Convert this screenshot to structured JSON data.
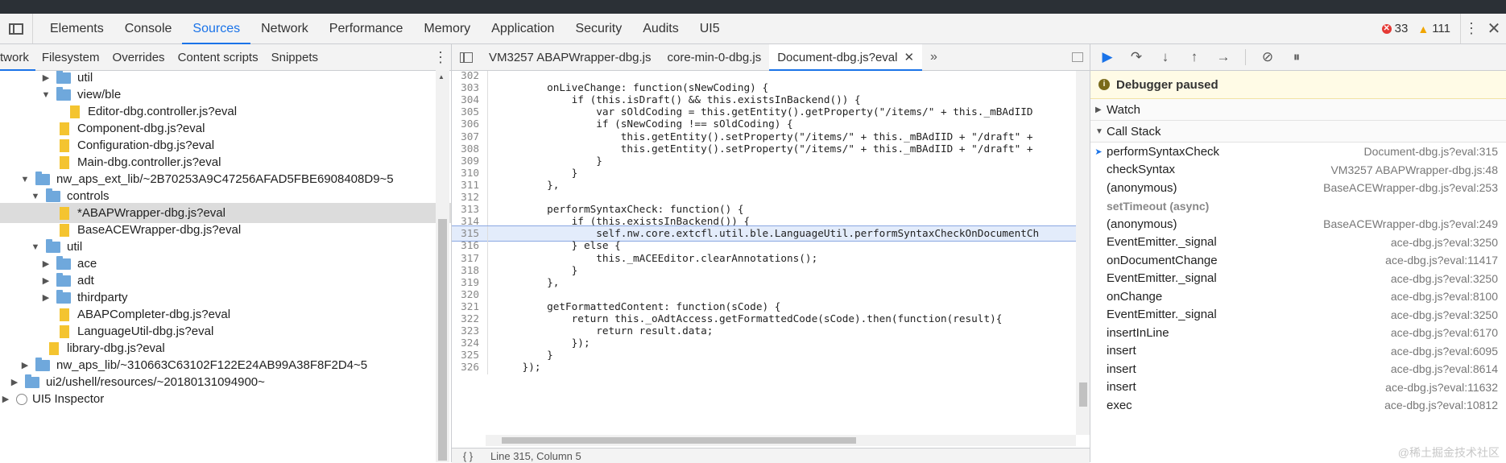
{
  "main_tabs": [
    "Elements",
    "Console",
    "Sources",
    "Network",
    "Performance",
    "Memory",
    "Application",
    "Security",
    "Audits",
    "UI5"
  ],
  "active_main_tab": "Sources",
  "errors": "33",
  "warnings": "111",
  "nav_tabs": [
    "twork",
    "Filesystem",
    "Overrides",
    "Content scripts",
    "Snippets"
  ],
  "tree": [
    {
      "label": "util",
      "kind": "folder",
      "level": 4,
      "arrow": "▶"
    },
    {
      "label": "view/ble",
      "kind": "folder",
      "level": 4,
      "arrow": "▼"
    },
    {
      "label": "Editor-dbg.controller.js?eval",
      "kind": "file",
      "level": 5
    },
    {
      "label": "Component-dbg.js?eval",
      "kind": "file",
      "level": 4
    },
    {
      "label": "Configuration-dbg.js?eval",
      "kind": "file",
      "level": 4
    },
    {
      "label": "Main-dbg.controller.js?eval",
      "kind": "file",
      "level": 4
    },
    {
      "label": "nw_aps_ext_lib/~2B70253A9C47256AFAD5FBE6908408D9~5",
      "kind": "folder",
      "level": 2,
      "arrow": "▼"
    },
    {
      "label": "controls",
      "kind": "folder",
      "level": 3,
      "arrow": "▼"
    },
    {
      "label": "*ABAPWrapper-dbg.js?eval",
      "kind": "file",
      "level": 4,
      "selected": true
    },
    {
      "label": "BaseACEWrapper-dbg.js?eval",
      "kind": "file",
      "level": 4
    },
    {
      "label": "util",
      "kind": "folder",
      "level": 3,
      "arrow": "▼"
    },
    {
      "label": "ace",
      "kind": "folder",
      "level": 4,
      "arrow": "▶"
    },
    {
      "label": "adt",
      "kind": "folder",
      "level": 4,
      "arrow": "▶"
    },
    {
      "label": "thirdparty",
      "kind": "folder",
      "level": 4,
      "arrow": "▶"
    },
    {
      "label": "ABAPCompleter-dbg.js?eval",
      "kind": "file",
      "level": 4
    },
    {
      "label": "LanguageUtil-dbg.js?eval",
      "kind": "file",
      "level": 4
    },
    {
      "label": "library-dbg.js?eval",
      "kind": "file",
      "level": 3
    },
    {
      "label": "nw_aps_lib/~310663C63102F122E24AB99A38F8F2D4~5",
      "kind": "folder",
      "level": 2,
      "arrow": "▶"
    },
    {
      "label": "ui2/ushell/resources/~20180131094900~",
      "kind": "folder",
      "level": 1,
      "arrow": "▶"
    },
    {
      "label": "UI5 Inspector",
      "kind": "root",
      "level": 0,
      "arrow": "▶"
    }
  ],
  "file_tabs": [
    {
      "label": "VM3257 ABAPWrapper-dbg.js",
      "active": false
    },
    {
      "label": "core-min-0-dbg.js",
      "active": false
    },
    {
      "label": "Document-dbg.js?eval",
      "active": true
    }
  ],
  "code_lines": [
    {
      "n": "302",
      "t": ""
    },
    {
      "n": "303",
      "t": "        onLiveChange: function(sNewCoding) {"
    },
    {
      "n": "304",
      "t": "            if (this.isDraft() && this.existsInBackend()) {"
    },
    {
      "n": "305",
      "t": "                var sOldCoding = this.getEntity().getProperty(\"/items/\" + this._mBAdIID"
    },
    {
      "n": "306",
      "t": "                if (sNewCoding !== sOldCoding) {"
    },
    {
      "n": "307",
      "t": "                    this.getEntity().setProperty(\"/items/\" + this._mBAdIID + \"/draft\" +"
    },
    {
      "n": "308",
      "t": "                    this.getEntity().setProperty(\"/items/\" + this._mBAdIID + \"/draft\" +"
    },
    {
      "n": "309",
      "t": "                }"
    },
    {
      "n": "310",
      "t": "            }"
    },
    {
      "n": "311",
      "t": "        },"
    },
    {
      "n": "312",
      "t": ""
    },
    {
      "n": "313",
      "t": "        performSyntaxCheck: function() {"
    },
    {
      "n": "314",
      "t": "            if (this.existsInBackend()) {"
    },
    {
      "n": "315",
      "t": "                self.nw.core.extcfl.util.ble.LanguageUtil.performSyntaxCheckOnDocumentCh",
      "hl": true
    },
    {
      "n": "316",
      "t": "            } else {"
    },
    {
      "n": "317",
      "t": "                this._mACEEditor.clearAnnotations();"
    },
    {
      "n": "318",
      "t": "            }"
    },
    {
      "n": "319",
      "t": "        },"
    },
    {
      "n": "320",
      "t": ""
    },
    {
      "n": "321",
      "t": "        getFormattedContent: function(sCode) {"
    },
    {
      "n": "322",
      "t": "            return this._oAdtAccess.getFormattedCode(sCode).then(function(result){"
    },
    {
      "n": "323",
      "t": "                return result.data;"
    },
    {
      "n": "324",
      "t": "            });"
    },
    {
      "n": "325",
      "t": "        }"
    },
    {
      "n": "326",
      "t": "    });"
    }
  ],
  "status_text": "Line 315, Column 5",
  "paused_text": "Debugger paused",
  "watch_label": "Watch",
  "callstack_label": "Call Stack",
  "frames": [
    {
      "fn": "performSyntaxCheck",
      "loc": "Document-dbg.js?eval:315",
      "current": true
    },
    {
      "fn": "checkSyntax",
      "loc": "VM3257 ABAPWrapper-dbg.js:48"
    },
    {
      "fn": "(anonymous)",
      "loc": "BaseACEWrapper-dbg.js?eval:253"
    },
    {
      "fn": "setTimeout (async)",
      "loc": "",
      "async": true
    },
    {
      "fn": "(anonymous)",
      "loc": "BaseACEWrapper-dbg.js?eval:249"
    },
    {
      "fn": "EventEmitter._signal",
      "loc": "ace-dbg.js?eval:3250"
    },
    {
      "fn": "onDocumentChange",
      "loc": "ace-dbg.js?eval:11417"
    },
    {
      "fn": "EventEmitter._signal",
      "loc": "ace-dbg.js?eval:3250"
    },
    {
      "fn": "onChange",
      "loc": "ace-dbg.js?eval:8100"
    },
    {
      "fn": "EventEmitter._signal",
      "loc": "ace-dbg.js?eval:3250"
    },
    {
      "fn": "insertInLine",
      "loc": "ace-dbg.js?eval:6170"
    },
    {
      "fn": "insert",
      "loc": "ace-dbg.js?eval:6095"
    },
    {
      "fn": "insert",
      "loc": "ace-dbg.js?eval:8614"
    },
    {
      "fn": "insert",
      "loc": "ace-dbg.js?eval:11632"
    },
    {
      "fn": "exec",
      "loc": "ace-dbg.js?eval:10812"
    }
  ],
  "watermark": "@稀土掘金技术社区",
  "colors": {
    "accent": "#1a73e8",
    "folder": "#6fa8dc",
    "file": "#f4c430",
    "paused_bg": "#fffbe6"
  }
}
